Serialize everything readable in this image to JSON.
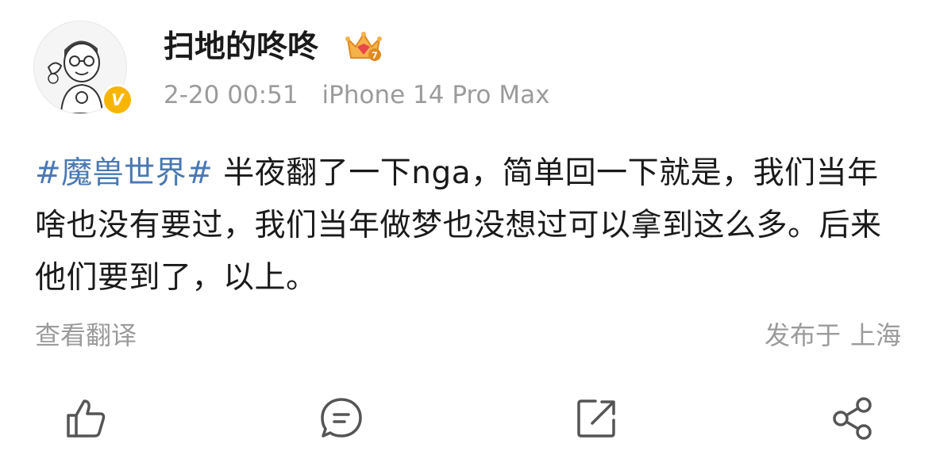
{
  "post": {
    "username": "扫地的咚咚",
    "timestamp": "2-20 00:51",
    "device": "iPhone 14 Pro Max",
    "verified_mark": "V",
    "topic": "#魔兽世界#",
    "text": " 半夜翻了一下nga，简单回一下就是，我们当年啥也没有要过，我们当年做梦也没想过可以拿到这么多。后来他们要到了，以上。"
  },
  "footer": {
    "translate_label": "查看翻译",
    "location_prefix": "发布于",
    "location": "上海"
  },
  "icons": {
    "avatar": "cartoon-avatar",
    "badge": "verified-v-icon",
    "crown": "crown-member-icon",
    "like": "thumbs-up-icon",
    "comment": "comment-icon",
    "repost": "repost-icon",
    "share": "share-icon"
  },
  "colors": {
    "topic": "#4a78b3",
    "muted": "#9b9b9b",
    "icon": "#555555",
    "badge": "#f7b500"
  }
}
